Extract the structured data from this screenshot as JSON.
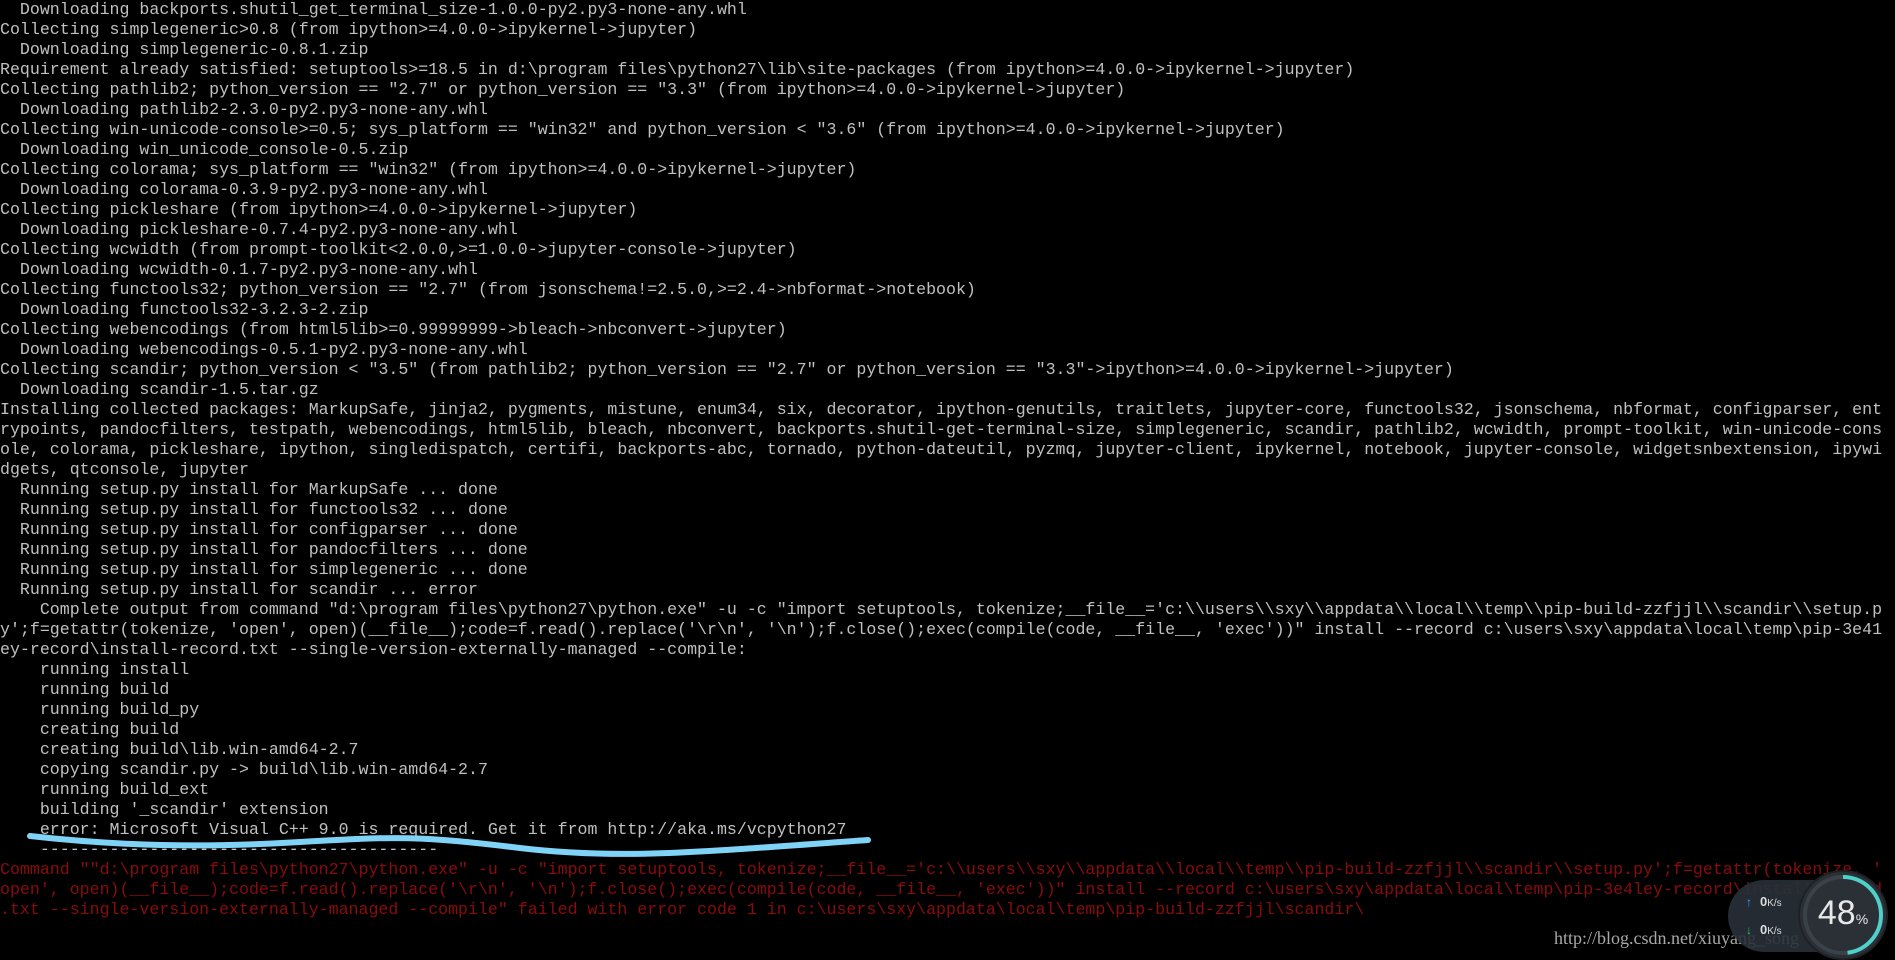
{
  "terminal": {
    "lines": [
      {
        "text": "  Downloading backports.shutil_get_terminal_size-1.0.0-py2.py3-none-any.whl"
      },
      {
        "text": "Collecting simplegeneric>0.8 (from ipython>=4.0.0->ipykernel->jupyter)"
      },
      {
        "text": "  Downloading simplegeneric-0.8.1.zip"
      },
      {
        "text": "Requirement already satisfied: setuptools>=18.5 in d:\\program files\\python27\\lib\\site-packages (from ipython>=4.0.0->ipykernel->jupyter)"
      },
      {
        "text": "Collecting pathlib2; python_version == \"2.7\" or python_version == \"3.3\" (from ipython>=4.0.0->ipykernel->jupyter)"
      },
      {
        "text": "  Downloading pathlib2-2.3.0-py2.py3-none-any.whl"
      },
      {
        "text": "Collecting win-unicode-console>=0.5; sys_platform == \"win32\" and python_version < \"3.6\" (from ipython>=4.0.0->ipykernel->jupyter)"
      },
      {
        "text": "  Downloading win_unicode_console-0.5.zip"
      },
      {
        "text": "Collecting colorama; sys_platform == \"win32\" (from ipython>=4.0.0->ipykernel->jupyter)"
      },
      {
        "text": "  Downloading colorama-0.3.9-py2.py3-none-any.whl"
      },
      {
        "text": "Collecting pickleshare (from ipython>=4.0.0->ipykernel->jupyter)"
      },
      {
        "text": "  Downloading pickleshare-0.7.4-py2.py3-none-any.whl"
      },
      {
        "text": "Collecting wcwidth (from prompt-toolkit<2.0.0,>=1.0.0->jupyter-console->jupyter)"
      },
      {
        "text": "  Downloading wcwidth-0.1.7-py2.py3-none-any.whl"
      },
      {
        "text": "Collecting functools32; python_version == \"2.7\" (from jsonschema!=2.5.0,>=2.4->nbformat->notebook)"
      },
      {
        "text": "  Downloading functools32-3.2.3-2.zip"
      },
      {
        "text": "Collecting webencodings (from html5lib>=0.99999999->bleach->nbconvert->jupyter)"
      },
      {
        "text": "  Downloading webencodings-0.5.1-py2.py3-none-any.whl"
      },
      {
        "text": "Collecting scandir; python_version < \"3.5\" (from pathlib2; python_version == \"2.7\" or python_version == \"3.3\"->ipython>=4.0.0->ipykernel->jupyter)"
      },
      {
        "text": "  Downloading scandir-1.5.tar.gz"
      },
      {
        "text": "Installing collected packages: MarkupSafe, jinja2, pygments, mistune, enum34, six, decorator, ipython-genutils, traitlets, jupyter-core, functools32, jsonschema, nbformat, configparser, ent"
      },
      {
        "text": "rypoints, pandocfilters, testpath, webencodings, html5lib, bleach, nbconvert, backports.shutil-get-terminal-size, simplegeneric, scandir, pathlib2, wcwidth, prompt-toolkit, win-unicode-cons"
      },
      {
        "text": "ole, colorama, pickleshare, ipython, singledispatch, certifi, backports-abc, tornado, python-dateutil, pyzmq, jupyter-client, ipykernel, notebook, jupyter-console, widgetsnbextension, ipywi"
      },
      {
        "text": "dgets, qtconsole, jupyter"
      },
      {
        "text": "  Running setup.py install for MarkupSafe ... done"
      },
      {
        "text": "  Running setup.py install for functools32 ... done"
      },
      {
        "text": "  Running setup.py install for configparser ... done"
      },
      {
        "text": "  Running setup.py install for pandocfilters ... done"
      },
      {
        "text": "  Running setup.py install for simplegeneric ... done"
      },
      {
        "text": "  Running setup.py install for scandir ... error"
      },
      {
        "text": "    Complete output from command \"d:\\program files\\python27\\python.exe\" -u -c \"import setuptools, tokenize;__file__='c:\\\\users\\\\sxy\\\\appdata\\\\local\\\\temp\\\\pip-build-zzfjjl\\\\scandir\\\\setup.p"
      },
      {
        "text": "y';f=getattr(tokenize, 'open', open)(__file__);code=f.read().replace('\\r\\n', '\\n');f.close();exec(compile(code, __file__, 'exec'))\" install --record c:\\users\\sxy\\appdata\\local\\temp\\pip-3e41"
      },
      {
        "text": "ey-record\\install-record.txt --single-version-externally-managed --compile:"
      },
      {
        "text": "    running install"
      },
      {
        "text": "    running build"
      },
      {
        "text": "    running build_py"
      },
      {
        "text": "    creating build"
      },
      {
        "text": "    creating build\\lib.win-amd64-2.7"
      },
      {
        "text": "    copying scandir.py -> build\\lib.win-amd64-2.7"
      },
      {
        "text": "    running build_ext"
      },
      {
        "text": "    building '_scandir' extension"
      },
      {
        "text": "    error: Microsoft Visual C++ 9.0 is required. Get it from http://aka.ms/vcpython27"
      },
      {
        "text": "    ----------------------------------------"
      },
      {
        "text": "Command \"\"d:\\program files\\python27\\python.exe\" -u -c \"import setuptools, tokenize;__file__='c:\\\\users\\\\sxy\\\\appdata\\\\local\\\\temp\\\\pip-build-zzfjjl\\\\scandir\\\\setup.py';f=getattr(tokenize, '",
        "error": true
      },
      {
        "text": "open', open)(__file__);code=f.read().replace('\\r\\n', '\\n');f.close();exec(compile(code, __file__, 'exec'))\" install --record c:\\users\\sxy\\appdata\\local\\temp\\pip-3e4ley-record\\install-record",
        "error": true
      },
      {
        "text": ".txt --single-version-externally-managed --compile\" failed with error code 1 in c:\\users\\sxy\\appdata\\local\\temp\\pip-build-zzfjjl\\scandir\\",
        "error": true
      }
    ]
  },
  "colors": {
    "text": "#c0c0c0",
    "error_text": "#8a0c0c",
    "highlight_underline": "#7fd3f7",
    "background": "#000000"
  },
  "network_widget": {
    "upload_speed": "0",
    "upload_unit": "K/s",
    "download_speed": "0",
    "download_unit": "K/s",
    "percent_value": "48",
    "percent_sign": "%",
    "percent": 48
  },
  "watermark": "http://blog.csdn.net/xiuyang_song"
}
